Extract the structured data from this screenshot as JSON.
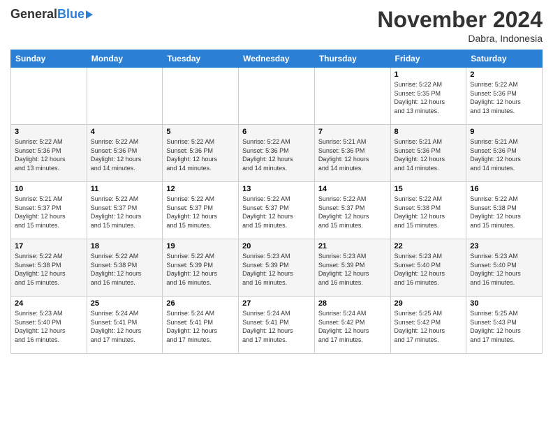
{
  "header": {
    "logo_general": "General",
    "logo_blue": "Blue",
    "month_title": "November 2024",
    "location": "Dabra, Indonesia"
  },
  "weekdays": [
    "Sunday",
    "Monday",
    "Tuesday",
    "Wednesday",
    "Thursday",
    "Friday",
    "Saturday"
  ],
  "rows": [
    [
      {
        "day": "",
        "text": ""
      },
      {
        "day": "",
        "text": ""
      },
      {
        "day": "",
        "text": ""
      },
      {
        "day": "",
        "text": ""
      },
      {
        "day": "",
        "text": ""
      },
      {
        "day": "1",
        "text": "Sunrise: 5:22 AM\nSunset: 5:35 PM\nDaylight: 12 hours\nand 13 minutes."
      },
      {
        "day": "2",
        "text": "Sunrise: 5:22 AM\nSunset: 5:36 PM\nDaylight: 12 hours\nand 13 minutes."
      }
    ],
    [
      {
        "day": "3",
        "text": "Sunrise: 5:22 AM\nSunset: 5:36 PM\nDaylight: 12 hours\nand 13 minutes."
      },
      {
        "day": "4",
        "text": "Sunrise: 5:22 AM\nSunset: 5:36 PM\nDaylight: 12 hours\nand 14 minutes."
      },
      {
        "day": "5",
        "text": "Sunrise: 5:22 AM\nSunset: 5:36 PM\nDaylight: 12 hours\nand 14 minutes."
      },
      {
        "day": "6",
        "text": "Sunrise: 5:22 AM\nSunset: 5:36 PM\nDaylight: 12 hours\nand 14 minutes."
      },
      {
        "day": "7",
        "text": "Sunrise: 5:21 AM\nSunset: 5:36 PM\nDaylight: 12 hours\nand 14 minutes."
      },
      {
        "day": "8",
        "text": "Sunrise: 5:21 AM\nSunset: 5:36 PM\nDaylight: 12 hours\nand 14 minutes."
      },
      {
        "day": "9",
        "text": "Sunrise: 5:21 AM\nSunset: 5:36 PM\nDaylight: 12 hours\nand 14 minutes."
      }
    ],
    [
      {
        "day": "10",
        "text": "Sunrise: 5:21 AM\nSunset: 5:37 PM\nDaylight: 12 hours\nand 15 minutes."
      },
      {
        "day": "11",
        "text": "Sunrise: 5:22 AM\nSunset: 5:37 PM\nDaylight: 12 hours\nand 15 minutes."
      },
      {
        "day": "12",
        "text": "Sunrise: 5:22 AM\nSunset: 5:37 PM\nDaylight: 12 hours\nand 15 minutes."
      },
      {
        "day": "13",
        "text": "Sunrise: 5:22 AM\nSunset: 5:37 PM\nDaylight: 12 hours\nand 15 minutes."
      },
      {
        "day": "14",
        "text": "Sunrise: 5:22 AM\nSunset: 5:37 PM\nDaylight: 12 hours\nand 15 minutes."
      },
      {
        "day": "15",
        "text": "Sunrise: 5:22 AM\nSunset: 5:38 PM\nDaylight: 12 hours\nand 15 minutes."
      },
      {
        "day": "16",
        "text": "Sunrise: 5:22 AM\nSunset: 5:38 PM\nDaylight: 12 hours\nand 15 minutes."
      }
    ],
    [
      {
        "day": "17",
        "text": "Sunrise: 5:22 AM\nSunset: 5:38 PM\nDaylight: 12 hours\nand 16 minutes."
      },
      {
        "day": "18",
        "text": "Sunrise: 5:22 AM\nSunset: 5:38 PM\nDaylight: 12 hours\nand 16 minutes."
      },
      {
        "day": "19",
        "text": "Sunrise: 5:22 AM\nSunset: 5:39 PM\nDaylight: 12 hours\nand 16 minutes."
      },
      {
        "day": "20",
        "text": "Sunrise: 5:23 AM\nSunset: 5:39 PM\nDaylight: 12 hours\nand 16 minutes."
      },
      {
        "day": "21",
        "text": "Sunrise: 5:23 AM\nSunset: 5:39 PM\nDaylight: 12 hours\nand 16 minutes."
      },
      {
        "day": "22",
        "text": "Sunrise: 5:23 AM\nSunset: 5:40 PM\nDaylight: 12 hours\nand 16 minutes."
      },
      {
        "day": "23",
        "text": "Sunrise: 5:23 AM\nSunset: 5:40 PM\nDaylight: 12 hours\nand 16 minutes."
      }
    ],
    [
      {
        "day": "24",
        "text": "Sunrise: 5:23 AM\nSunset: 5:40 PM\nDaylight: 12 hours\nand 16 minutes."
      },
      {
        "day": "25",
        "text": "Sunrise: 5:24 AM\nSunset: 5:41 PM\nDaylight: 12 hours\nand 17 minutes."
      },
      {
        "day": "26",
        "text": "Sunrise: 5:24 AM\nSunset: 5:41 PM\nDaylight: 12 hours\nand 17 minutes."
      },
      {
        "day": "27",
        "text": "Sunrise: 5:24 AM\nSunset: 5:41 PM\nDaylight: 12 hours\nand 17 minutes."
      },
      {
        "day": "28",
        "text": "Sunrise: 5:24 AM\nSunset: 5:42 PM\nDaylight: 12 hours\nand 17 minutes."
      },
      {
        "day": "29",
        "text": "Sunrise: 5:25 AM\nSunset: 5:42 PM\nDaylight: 12 hours\nand 17 minutes."
      },
      {
        "day": "30",
        "text": "Sunrise: 5:25 AM\nSunset: 5:43 PM\nDaylight: 12 hours\nand 17 minutes."
      }
    ]
  ]
}
